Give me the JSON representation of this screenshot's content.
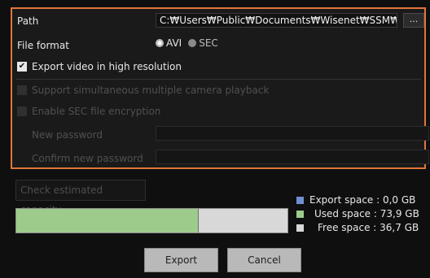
{
  "path": {
    "label": "Path",
    "value": "C:₩Users₩Public₩Documents₩Wisenet₩SSM₩",
    "browse_label": "..."
  },
  "file_format": {
    "label": "File format",
    "options": [
      {
        "label": "AVI",
        "selected": true
      },
      {
        "label": "SEC",
        "selected": false
      }
    ]
  },
  "high_resolution": {
    "label": "Export video in high resolution",
    "checked": true
  },
  "multi_playback": {
    "label": "Support simultaneous multiple camera playback",
    "checked": false,
    "enabled": false
  },
  "sec_encryption": {
    "label": "Enable SEC file encryption",
    "checked": false,
    "enabled": false
  },
  "new_password": {
    "label": "New password",
    "value": ""
  },
  "confirm_password": {
    "label": "Confirm new password",
    "value": ""
  },
  "check_capacity_label": "Check estimated capacity",
  "capacity": {
    "used_fraction": 0.67,
    "legend": [
      {
        "label": "Export space",
        "value": "0,0 GB",
        "color": "#6f8fce"
      },
      {
        "label": "Used space",
        "value": "73,9 GB",
        "color": "#9dcb8c"
      },
      {
        "label": "Free space",
        "value": "36,7 GB",
        "color": "#d8d8d8"
      }
    ]
  },
  "buttons": {
    "export": "Export",
    "cancel": "Cancel"
  },
  "colors": {
    "accent": "#e2743a",
    "used": "#9dcb8c",
    "free": "#d8d8d8",
    "export": "#6f8fce"
  }
}
